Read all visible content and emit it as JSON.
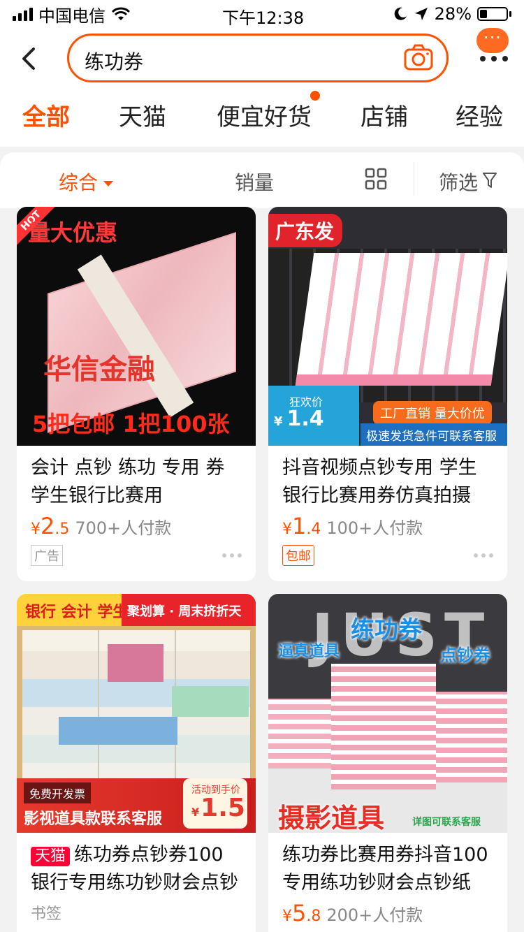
{
  "status_bar": {
    "carrier": "中国电信",
    "time": "下午12:38",
    "battery": "28%",
    "battery_level": 0.28
  },
  "header": {
    "search_query": "练功券",
    "more_bubble": "···"
  },
  "tabs": [
    {
      "label": "全部"
    },
    {
      "label": "天猫"
    },
    {
      "label": "便宜好货"
    },
    {
      "label": "店铺"
    },
    {
      "label": "经验"
    }
  ],
  "filters": {
    "sort": "综合",
    "sales": "销量",
    "filter": "筛选"
  },
  "products": [
    {
      "title": "会计 点钞 练功 专用 券 学生银行比赛用",
      "price_symbol": "¥",
      "price_int": "2",
      "price_dec": ".5",
      "sold": "700+人付款",
      "tag": "广告",
      "image_text": {
        "hot": "HOT",
        "top": "量大优惠",
        "mid": "华信金融",
        "bottom": "5把包邮 1把100张"
      }
    },
    {
      "title": "抖音视频点钞专用 学生银行比赛用券仿真拍摄",
      "price_symbol": "¥",
      "price_int": "1",
      "price_dec": ".4",
      "sold": "100+人付款",
      "tag": "包邮",
      "image_text": {
        "corner": "广东发",
        "promo_label": "狂欢价",
        "promo_symbol": "¥",
        "promo_price": "1.4",
        "orange": "工厂直销 量大价优",
        "blue": "极速发货急件可联系客服"
      }
    },
    {
      "tmall_badge": "天猫",
      "title": "练功券点钞券100银行专用练功钞财会点钞",
      "bookmark": "书签",
      "image_text": {
        "strip_left": "银行 会计 学生",
        "strip_right": "聚划算 · 周末挤折天",
        "invoice": "免费开发票",
        "service": "影视道具款联系客服",
        "price_label": "活动到手价",
        "price_symbol": "¥",
        "price": "1.5"
      }
    },
    {
      "title": "练功券比赛用券抖音100专用练功钞财会点钞纸",
      "price_symbol": "¥",
      "price_int": "5",
      "price_dec": ".8",
      "sold": "200+人付款",
      "image_text": {
        "bg": "JUST",
        "main": "练功券",
        "left": "逼真道具",
        "right": "点钞券",
        "bottom": "摄影道具",
        "note": "详图可联系客服"
      }
    }
  ],
  "colors": {
    "accent": "#ff5000",
    "tmall": "#ff0036"
  }
}
